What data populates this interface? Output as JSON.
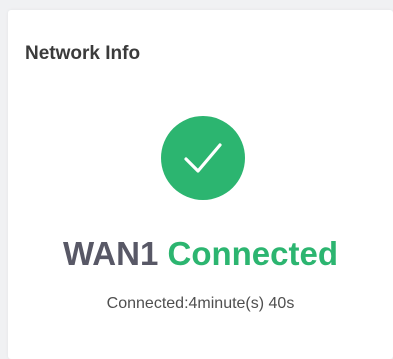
{
  "card": {
    "title": "Network Info"
  },
  "status": {
    "icon": "checkmark-circle-icon",
    "wan_name": "WAN1",
    "state": "Connected",
    "duration_text": "Connected:4minute(s) 40s",
    "success_color": "#2cb570"
  }
}
